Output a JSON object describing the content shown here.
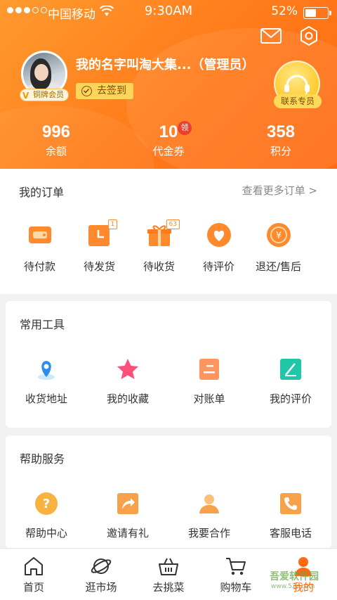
{
  "status_bar": {
    "carrier": "中国移动",
    "time": "9:30AM",
    "battery": "52%",
    "battery_level": 0.52
  },
  "header": {
    "username": "我的名字叫淘大集...（管理员）",
    "member_badge": "铜牌会员",
    "checkin_label": "去签到",
    "support_label": "联系专员",
    "icons": [
      "mail-icon",
      "settings-icon"
    ]
  },
  "stats": [
    {
      "value": "996",
      "label": "余额"
    },
    {
      "value": "10",
      "label": "代金券",
      "badge": "领"
    },
    {
      "value": "358",
      "label": "积分"
    }
  ],
  "orders": {
    "title": "我的订单",
    "more": "查看更多订单 >",
    "items": [
      {
        "label": "待付款",
        "icon": "wallet-icon"
      },
      {
        "label": "待发货",
        "icon": "clock-icon",
        "count": "1"
      },
      {
        "label": "待收货",
        "icon": "gift-icon",
        "count": "63"
      },
      {
        "label": "待评价",
        "icon": "heart-icon"
      },
      {
        "label": "退还/售后",
        "icon": "refund-icon"
      }
    ]
  },
  "tools": {
    "title": "常用工具",
    "items": [
      {
        "label": "收货地址",
        "icon": "location-icon"
      },
      {
        "label": "我的收藏",
        "icon": "star-icon"
      },
      {
        "label": "对账单",
        "icon": "statement-icon"
      },
      {
        "label": "我的评价",
        "icon": "review-icon"
      }
    ]
  },
  "help": {
    "title": "帮助服务",
    "items": [
      {
        "label": "帮助中心",
        "icon": "help-icon"
      },
      {
        "label": "邀请有礼",
        "icon": "share-icon"
      },
      {
        "label": "我要合作",
        "icon": "person-icon"
      },
      {
        "label": "客服电话",
        "icon": "phone-icon"
      }
    ]
  },
  "tabbar": [
    {
      "label": "首页",
      "icon": "home-icon"
    },
    {
      "label": "逛市场",
      "icon": "planet-icon"
    },
    {
      "label": "去挑菜",
      "icon": "basket-icon"
    },
    {
      "label": "购物车",
      "icon": "cart-icon"
    },
    {
      "label": "我的",
      "icon": "profile-icon",
      "active": true
    }
  ],
  "watermark": {
    "text": "吾爱软件园",
    "url": "www.52z.com"
  },
  "colors": {
    "accent": "#ff7a1a",
    "badge_red": "#e9402f",
    "gold": "#ffd45a"
  }
}
